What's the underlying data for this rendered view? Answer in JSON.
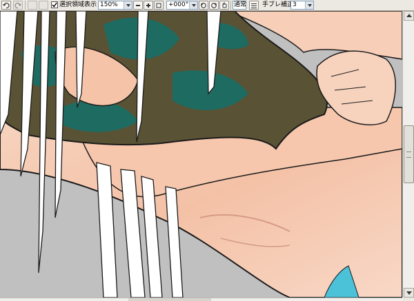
{
  "toolbar": {
    "selection_display_checked": true,
    "selection_display_label": "選択領域表示",
    "zoom_value": "150%",
    "rotation_value": "+000°",
    "blend_mode_value": "通常",
    "stabilizer_label": "手ブレ補正",
    "stabilizer_value": "3"
  },
  "icons": {
    "undo": "undo-arrow-icon",
    "redo": "redo-arrow-icon",
    "zoom_out": "minus-icon",
    "zoom_in": "plus-icon",
    "rotate_left": "rotate-left-icon",
    "rotate_right": "rotate-right-icon",
    "hand": "hand-icon"
  },
  "colors": {
    "toolbar_bg": "#ece9e2",
    "canvas_bg": "#c0c0c0",
    "skin": "#f6c8b0",
    "hair": "#ffffff",
    "shirt_olive": "#5a5234",
    "shirt_teal": "#1e6b62"
  }
}
